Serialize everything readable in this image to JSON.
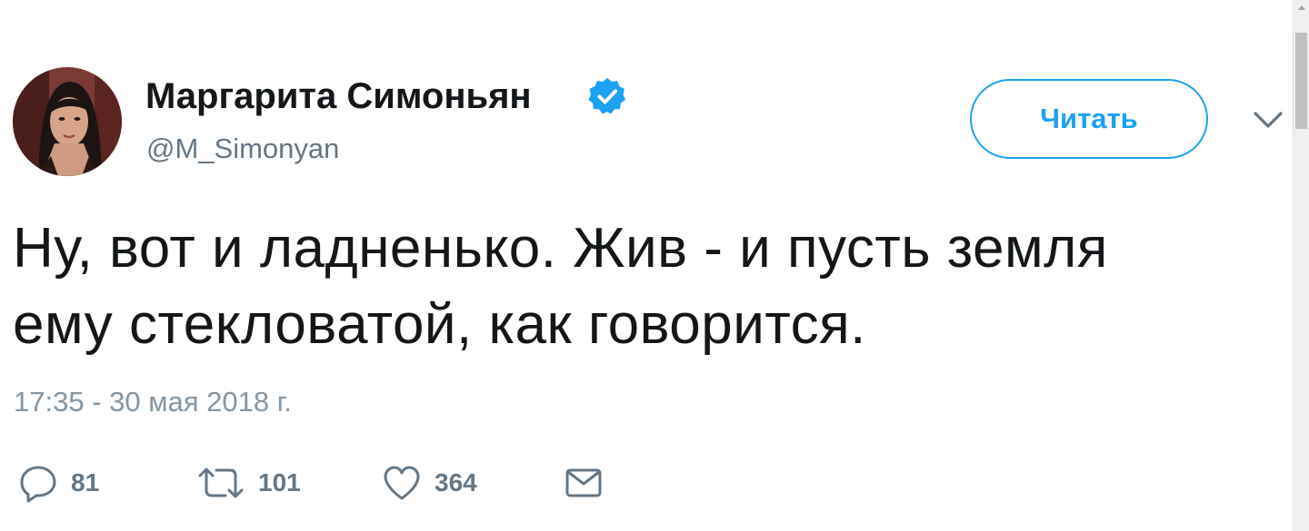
{
  "author": {
    "display_name": "Маргарита Симоньян",
    "handle": "@M_Simonyan",
    "verified": true
  },
  "follow_button": {
    "label": "Читать"
  },
  "tweet": {
    "text_line_1": "Ну, вот и ладненько. Жив - и пусть земля",
    "text_line_2": "ему стекловатой, как говорится.",
    "timestamp": "17:35 - 30 мая 2018 г."
  },
  "actions": {
    "replies": "81",
    "retweets": "101",
    "likes": "364"
  },
  "icons": {
    "verified": "verified-badge-icon",
    "caret": "chevron-down-icon",
    "reply": "reply-icon",
    "retweet": "retweet-icon",
    "like": "heart-icon",
    "dm": "envelope-icon"
  },
  "colors": {
    "accent": "#1da1f2",
    "text": "#14171a",
    "secondary_text": "#657786"
  }
}
